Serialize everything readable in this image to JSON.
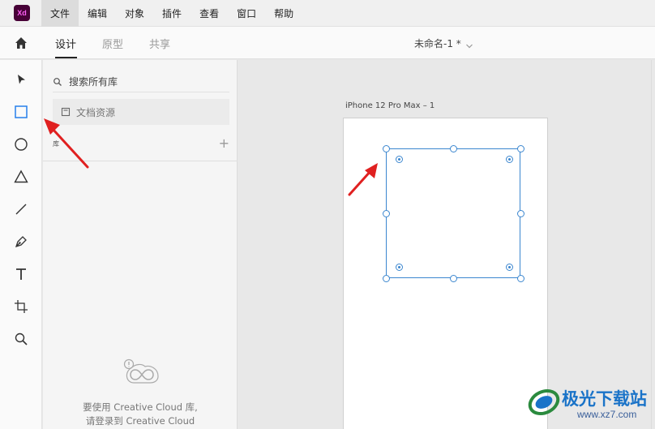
{
  "app": {
    "logo_text": "Xd"
  },
  "menu": {
    "items": [
      {
        "label": "文件"
      },
      {
        "label": "编辑"
      },
      {
        "label": "对象"
      },
      {
        "label": "插件"
      },
      {
        "label": "查看"
      },
      {
        "label": "窗口"
      },
      {
        "label": "帮助"
      }
    ],
    "active_index": 0
  },
  "tabs": {
    "items": [
      {
        "label": "设计"
      },
      {
        "label": "原型"
      },
      {
        "label": "共享"
      }
    ],
    "active_index": 0
  },
  "document": {
    "title": "未命名-1 *"
  },
  "toolbar": {
    "tools": [
      {
        "icon": "select-arrow-icon"
      },
      {
        "icon": "rectangle-icon",
        "active": true
      },
      {
        "icon": "ellipse-icon"
      },
      {
        "icon": "polygon-icon"
      },
      {
        "icon": "line-icon"
      },
      {
        "icon": "pen-icon"
      },
      {
        "icon": "text-icon"
      },
      {
        "icon": "artboard-icon"
      },
      {
        "icon": "zoom-icon"
      }
    ],
    "active_color": "#2680eb"
  },
  "library": {
    "search_label": "搜索所有库",
    "doc_assets_label": "文档资源",
    "section_label": "库",
    "add_symbol": "+",
    "cc_message_line1": "要使用 Creative Cloud 库,",
    "cc_message_line2": "请登录到 Creative Cloud"
  },
  "canvas": {
    "artboard_title": "iPhone 12 Pro Max – 1",
    "selection_color": "#3b86cf"
  },
  "annotation": {
    "arrow_color": "#e02020"
  },
  "watermark": {
    "text": "极光下载站",
    "url": "www.xz7.com"
  }
}
